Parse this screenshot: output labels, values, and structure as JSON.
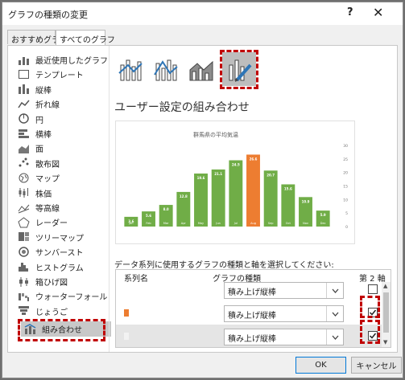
{
  "window": {
    "title": "グラフの種類の変更",
    "help_label": "?",
    "close_label": "✕"
  },
  "tabs": [
    {
      "label": "おすすめグラフ"
    },
    {
      "label": "すべてのグラフ"
    }
  ],
  "types": [
    {
      "label": "最近使用したグラフ",
      "icon": "recent-chart-icon"
    },
    {
      "label": "テンプレート",
      "icon": "template-icon"
    },
    {
      "label": "縦棒",
      "icon": "column-chart-icon"
    },
    {
      "label": "折れ線",
      "icon": "line-chart-icon"
    },
    {
      "label": "円",
      "icon": "pie-chart-icon"
    },
    {
      "label": "横棒",
      "icon": "bar-chart-icon"
    },
    {
      "label": "面",
      "icon": "area-chart-icon"
    },
    {
      "label": "散布図",
      "icon": "scatter-chart-icon"
    },
    {
      "label": "マップ",
      "icon": "map-chart-icon"
    },
    {
      "label": "株価",
      "icon": "stock-chart-icon"
    },
    {
      "label": "等高線",
      "icon": "surface-chart-icon"
    },
    {
      "label": "レーダー",
      "icon": "radar-chart-icon"
    },
    {
      "label": "ツリーマップ",
      "icon": "treemap-chart-icon"
    },
    {
      "label": "サンバースト",
      "icon": "sunburst-chart-icon"
    },
    {
      "label": "ヒストグラム",
      "icon": "histogram-chart-icon"
    },
    {
      "label": "箱ひげ図",
      "icon": "boxwhisker-chart-icon"
    },
    {
      "label": "ウォーターフォール",
      "icon": "waterfall-chart-icon"
    },
    {
      "label": "じょうご",
      "icon": "funnel-chart-icon"
    },
    {
      "label": "組み合わせ",
      "icon": "combo-chart-icon"
    }
  ],
  "section_title": "ユーザー設定の組み合わせ",
  "colors": {
    "bar_green": "#70ad47",
    "bar_orange": "#ed7d31",
    "highlight": "#c00000",
    "ok_border": "#0078d7"
  },
  "chart_data": {
    "type": "bar",
    "title": "群馬県の平均気温",
    "categories": [
      "Jan",
      "Feb",
      "Mar",
      "Apr",
      "May",
      "Jun",
      "Jul",
      "Aug",
      "Sep",
      "Oct",
      "Nov",
      "Dec"
    ],
    "values": [
      3.6,
      5.6,
      8.0,
      12.8,
      19.6,
      21.1,
      24.5,
      26.6,
      20.7,
      15.6,
      10.9,
      5.9
    ],
    "value_labels": [
      "3.6",
      "5.6",
      "8.0",
      "12.8",
      "19.6",
      "21.1",
      "24.5",
      "26.6",
      "20.7",
      "15.6",
      "10.9",
      "5.9"
    ],
    "highlight_index": 7,
    "ylim": [
      0,
      30
    ],
    "yticks": [
      "30",
      "25",
      "20",
      "15",
      "10",
      "5",
      "0"
    ],
    "grid": false,
    "legend": "none"
  },
  "series_prompt": "データ系列に使用するグラフの種類と軸を選択してください:",
  "series_table": {
    "headers": {
      "name": "系列名",
      "type": "グラフの種類",
      "axis": "第 2 軸"
    },
    "rows": [
      {
        "swatch": "#ffffff",
        "type": "積み上げ縦棒",
        "secondary": false
      },
      {
        "swatch": "#ed7d31",
        "type": "積み上げ縦棒",
        "secondary": true
      },
      {
        "swatch": "#f2f2f2",
        "type": "積み上げ縦棒",
        "secondary": true
      }
    ]
  },
  "buttons": {
    "ok": "OK",
    "cancel": "キャンセル"
  }
}
